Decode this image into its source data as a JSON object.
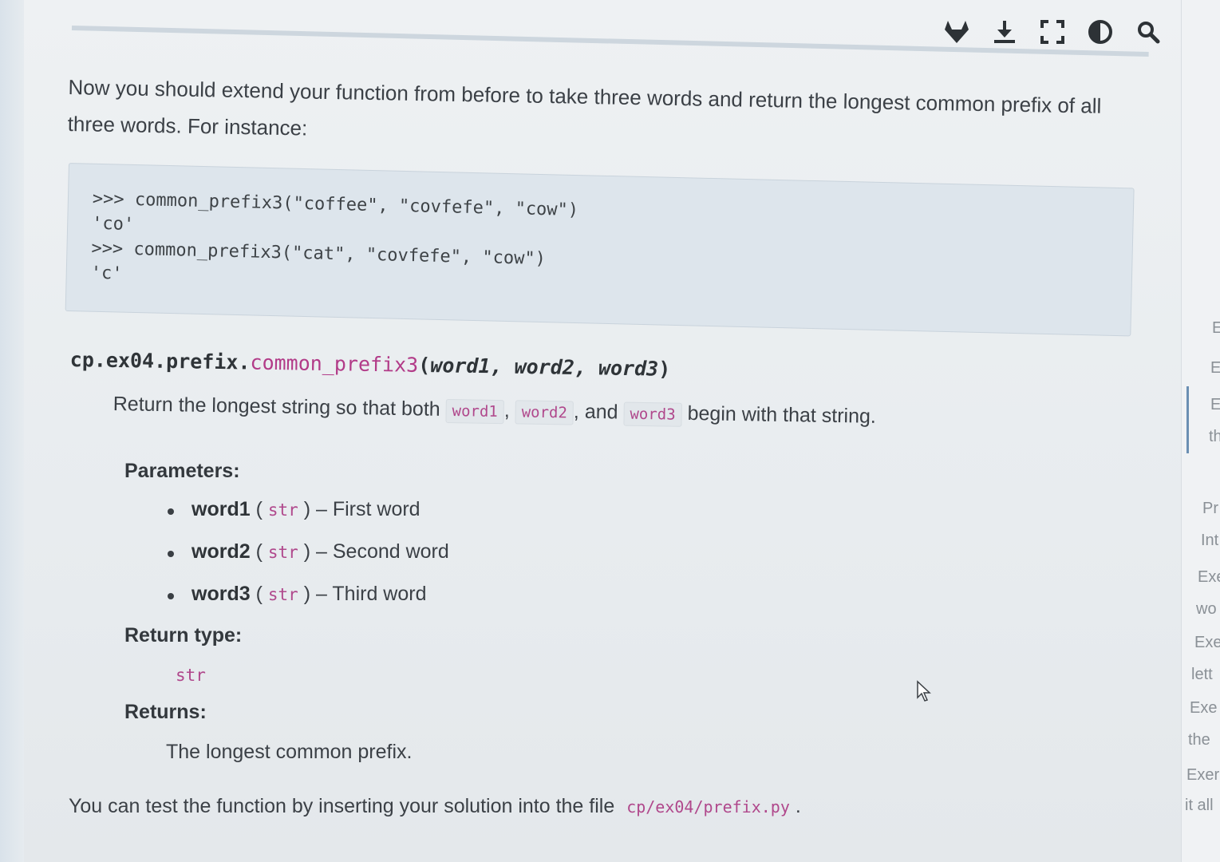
{
  "toolbar": {
    "icons": [
      "gitlab-icon",
      "download-icon",
      "fullscreen-icon",
      "contrast-icon",
      "search-icon"
    ]
  },
  "intro": {
    "text": "Now you should extend your function from before to take three words and return the longest common prefix of all three words. For instance:"
  },
  "example": {
    "lines": [
      ">>> common_prefix3(\"coffee\", \"covfefe\", \"cow\")",
      "'co'",
      ">>> common_prefix3(\"cat\", \"covfefe\", \"cow\")",
      "'c'"
    ]
  },
  "signature": {
    "module": "cp.ex04.prefix.",
    "name": "common_prefix3",
    "open": "(",
    "params": "word1, word2, word3",
    "close": ")"
  },
  "description": {
    "before": "Return the longest string so that both",
    "code1": "word1",
    "sep1": ",",
    "code2": "word2",
    "sep2": ", and",
    "code3": "word3",
    "after": "begin with that string."
  },
  "parameters": {
    "label": "Parameters:",
    "items": [
      {
        "name": "word1",
        "type": "str",
        "desc": "First word"
      },
      {
        "name": "word2",
        "type": "str",
        "desc": "Second word"
      },
      {
        "name": "word3",
        "type": "str",
        "desc": "Third word"
      }
    ]
  },
  "return_type": {
    "label": "Return type:",
    "value": "str"
  },
  "returns": {
    "label": "Returns:",
    "value": "The longest common prefix."
  },
  "footer": {
    "text": "You can test the function by inserting your solution into the file",
    "path": "cp/ex04/prefix.py",
    "end": "."
  },
  "right_panel": {
    "items": [
      "E",
      "E",
      "E",
      "th",
      "Pr",
      "Int",
      "Exe",
      "wo",
      "Exe",
      "lett",
      "Exe",
      "the",
      "Exer",
      "it all"
    ]
  },
  "colors": {
    "code_accent": "#b0488c",
    "code_bg": "#dde5ec",
    "page_bg": "#e9edf0"
  }
}
